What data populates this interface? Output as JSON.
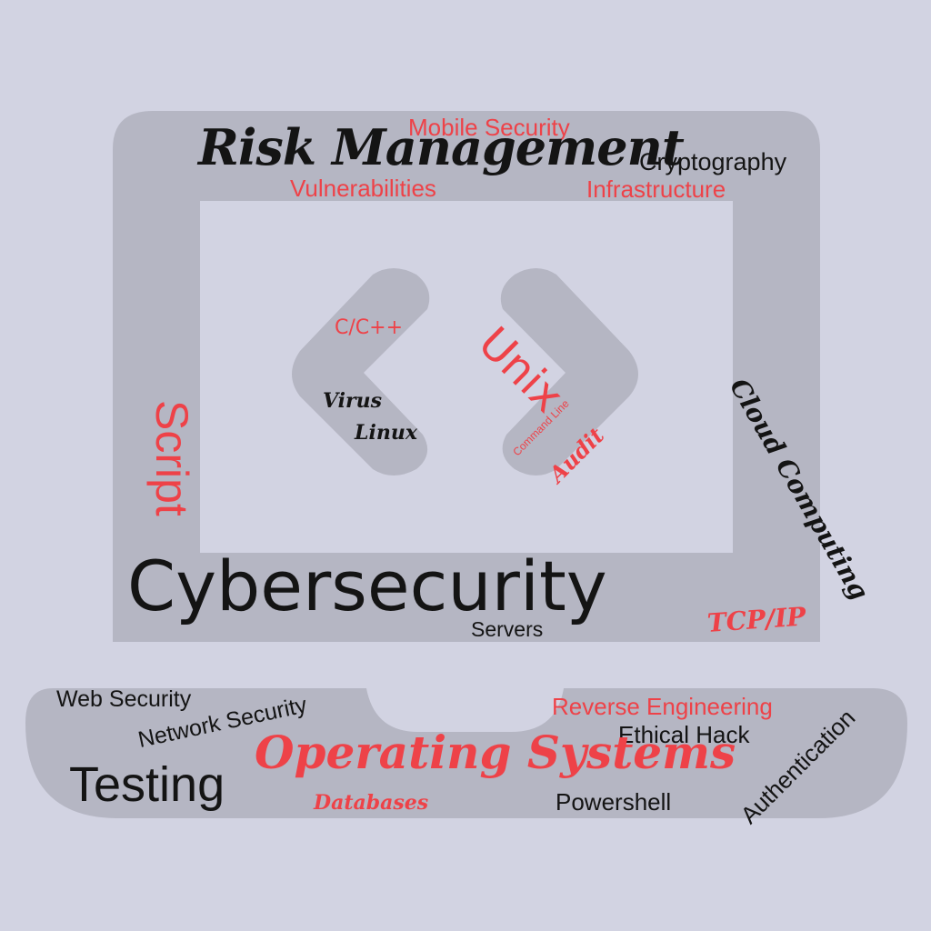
{
  "words": {
    "mobile_security": "Mobile Security",
    "risk_management": "Risk Management",
    "cryptography": "Cryptography",
    "vulnerabilities": "Vulnerabilities",
    "infrastructure": "Infrastructure",
    "c_cpp": "C/C++",
    "unix": "Unix",
    "virus": "Virus",
    "linux": "Linux",
    "command_line": "Command Line",
    "audit": "Audit",
    "script": "Script",
    "cloud_computing": "Cloud Computing",
    "cybersecurity": "Cybersecurity",
    "servers": "Servers",
    "tcp_ip": "TCP/IP",
    "web_security": "Web Security",
    "network_security": "Network Security",
    "reverse_engineering": "Reverse Engineering",
    "ethical_hack": "Ethical Hack",
    "authentication": "Authentication",
    "operating_systems": "Operating Systems",
    "testing": "Testing",
    "databases": "Databases",
    "powershell": "Powershell"
  },
  "colors": {
    "background": "#d2d3e2",
    "laptop_frame": "#b5b6c3",
    "screen": "#d2d3e2",
    "accent_red": "#ee4248",
    "text_black": "#141414"
  },
  "icons": [
    "laptop-icon",
    "code-brackets-icon"
  ]
}
